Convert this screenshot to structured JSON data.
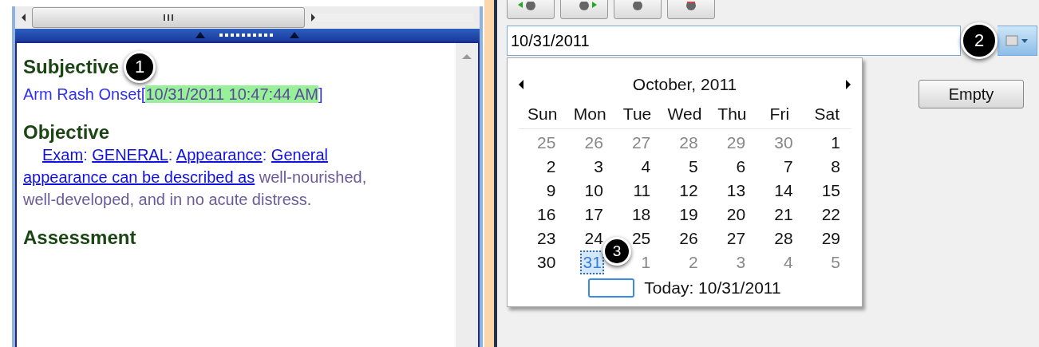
{
  "note": {
    "sections": [
      {
        "heading": "Subjective",
        "lines": [
          {
            "kind": "text",
            "text": "Arm Rash Onset"
          },
          {
            "kind": "bracket",
            "text": "["
          },
          {
            "kind": "highlight",
            "text": "10/31/2011 10:47:44 AM"
          },
          {
            "kind": "bracket",
            "text": "]"
          }
        ]
      },
      {
        "heading": "Objective",
        "lines": [
          {
            "kind": "link",
            "text": "Exam"
          },
          {
            "kind": "text",
            "text": ": "
          },
          {
            "kind": "link",
            "text": "GENERAL"
          },
          {
            "kind": "text",
            "text": ": "
          },
          {
            "kind": "link",
            "text": "Appearance"
          },
          {
            "kind": "text",
            "text": ": "
          },
          {
            "kind": "link",
            "text": "General"
          },
          {
            "kind": "space"
          },
          {
            "kind": "link",
            "text": "appearance can be described as"
          },
          {
            "kind": "plain",
            "text": " well-nourished, well-developed, and in no acute distress."
          }
        ]
      },
      {
        "heading": "Assessment"
      }
    ]
  },
  "toolbar": [
    {
      "kind": "back"
    },
    {
      "kind": "forward"
    },
    {
      "kind": "dot-gray"
    },
    {
      "kind": "dot-red"
    }
  ],
  "date_field": {
    "value": "10/31/2011"
  },
  "calendar": {
    "month": "October, 2011",
    "weekdays": [
      "Sun",
      "Mon",
      "Tue",
      "Wed",
      "Thu",
      "Fri",
      "Sat"
    ],
    "weeks": [
      [
        {
          "day": "25",
          "other": true,
          "selected": false
        },
        {
          "day": "26",
          "other": true,
          "selected": false
        },
        {
          "day": "27",
          "other": true,
          "selected": false
        },
        {
          "day": "28",
          "other": true,
          "selected": false
        },
        {
          "day": "29",
          "other": true,
          "selected": false
        },
        {
          "day": "30",
          "other": true,
          "selected": false
        },
        {
          "day": "1",
          "other": false,
          "selected": false
        }
      ],
      [
        {
          "day": "2",
          "other": false,
          "selected": false
        },
        {
          "day": "3",
          "other": false,
          "selected": false
        },
        {
          "day": "4",
          "other": false,
          "selected": false
        },
        {
          "day": "5",
          "other": false,
          "selected": false
        },
        {
          "day": "6",
          "other": false,
          "selected": false
        },
        {
          "day": "7",
          "other": false,
          "selected": false
        },
        {
          "day": "8",
          "other": false,
          "selected": false
        }
      ],
      [
        {
          "day": "9",
          "other": false,
          "selected": false
        },
        {
          "day": "10",
          "other": false,
          "selected": false
        },
        {
          "day": "11",
          "other": false,
          "selected": false
        },
        {
          "day": "12",
          "other": false,
          "selected": false
        },
        {
          "day": "13",
          "other": false,
          "selected": false
        },
        {
          "day": "14",
          "other": false,
          "selected": false
        },
        {
          "day": "15",
          "other": false,
          "selected": false
        }
      ],
      [
        {
          "day": "16",
          "other": false,
          "selected": false
        },
        {
          "day": "17",
          "other": false,
          "selected": false
        },
        {
          "day": "18",
          "other": false,
          "selected": false
        },
        {
          "day": "19",
          "other": false,
          "selected": false
        },
        {
          "day": "20",
          "other": false,
          "selected": false
        },
        {
          "day": "21",
          "other": false,
          "selected": false
        },
        {
          "day": "22",
          "other": false,
          "selected": false
        }
      ],
      [
        {
          "day": "23",
          "other": false,
          "selected": false
        },
        {
          "day": "24",
          "other": false,
          "selected": false
        },
        {
          "day": "25",
          "other": false,
          "selected": false
        },
        {
          "day": "26",
          "other": false,
          "selected": false
        },
        {
          "day": "27",
          "other": false,
          "selected": false
        },
        {
          "day": "28",
          "other": false,
          "selected": false
        },
        {
          "day": "29",
          "other": false,
          "selected": false
        }
      ],
      [
        {
          "day": "30",
          "other": false,
          "selected": false
        },
        {
          "day": "31",
          "other": false,
          "selected": true
        },
        {
          "day": "1",
          "other": true,
          "selected": false
        },
        {
          "day": "2",
          "other": true,
          "selected": false
        },
        {
          "day": "3",
          "other": true,
          "selected": false
        },
        {
          "day": "4",
          "other": true,
          "selected": false
        },
        {
          "day": "5",
          "other": true,
          "selected": false
        }
      ]
    ],
    "today": "Today: 10/31/2011"
  },
  "empty_button": {
    "label": "Empty"
  },
  "callouts": [
    "1",
    "2",
    "3"
  ]
}
